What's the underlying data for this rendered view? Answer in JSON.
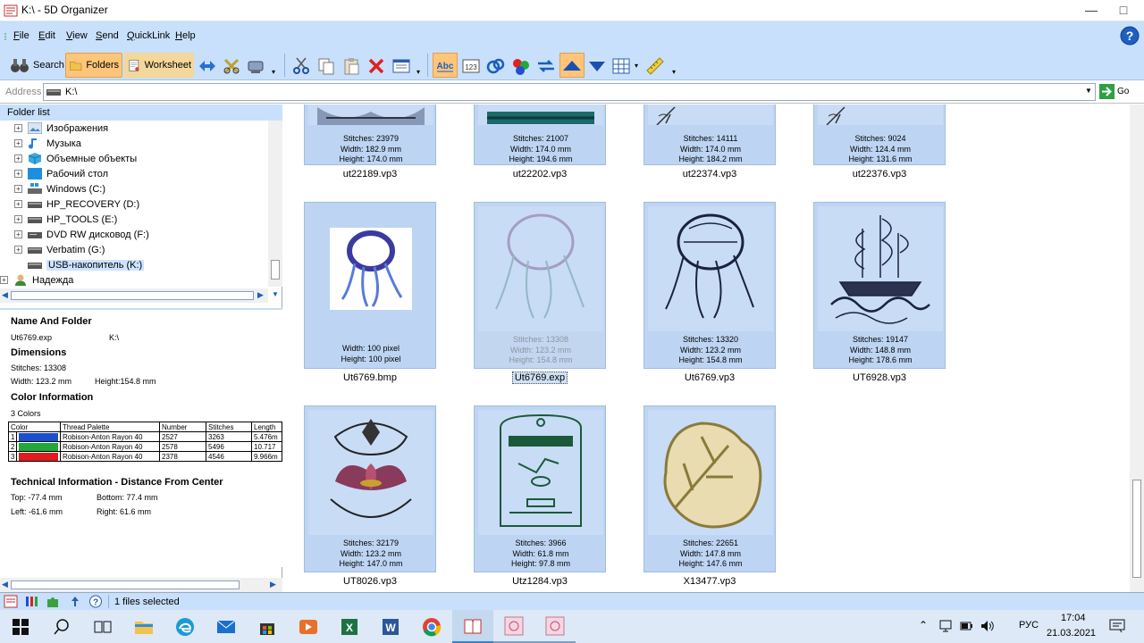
{
  "window": {
    "title": "K:\\ - 5D Organizer"
  },
  "menu": [
    {
      "key": "F",
      "rest": "ile"
    },
    {
      "key": "E",
      "rest": "dit"
    },
    {
      "key": "V",
      "rest": "iew"
    },
    {
      "key": "S",
      "rest": "end"
    },
    {
      "key": "Q",
      "rest": "uickLink"
    },
    {
      "key": "H",
      "rest": "elp"
    }
  ],
  "toolbar": {
    "search": "Search",
    "folders": "Folders",
    "worksheet": "Worksheet"
  },
  "address": {
    "label": "Address",
    "value": "K:\\",
    "go": "Go"
  },
  "folder_list": {
    "header": "Folder list",
    "items": [
      {
        "label": "Изображения",
        "icon": "pictures-folder-icon"
      },
      {
        "label": "Музыка",
        "icon": "music-folder-icon"
      },
      {
        "label": "Объемные объекты",
        "icon": "3d-objects-icon"
      },
      {
        "label": "Рабочий стол",
        "icon": "desktop-folder-icon"
      },
      {
        "label": "Windows (C:)",
        "icon": "windows-drive-icon"
      },
      {
        "label": "HP_RECOVERY (D:)",
        "icon": "drive-icon"
      },
      {
        "label": "HP_TOOLS (E:)",
        "icon": "drive-icon"
      },
      {
        "label": "DVD RW дисковод (F:)",
        "icon": "dvd-drive-icon"
      },
      {
        "label": "Verbatim (G:)",
        "icon": "drive-icon"
      },
      {
        "label": "USB-накопитель (K:)",
        "icon": "usb-drive-icon"
      },
      {
        "label": "Надежда",
        "icon": "user-icon"
      }
    ]
  },
  "info": {
    "name_and_folder": "Name And Folder",
    "filename": "Ut6769.exp",
    "folder": "K:\\",
    "dimensions": "Dimensions",
    "stitches": "Stitches: 13308",
    "width": "Width: 123.2 mm",
    "height": "Height:154.8 mm",
    "color_information": "Color Information",
    "colors_count": "3 Colors",
    "color_table_headers": [
      "Color",
      "Thread Palette",
      "Number",
      "Stitches",
      "Length"
    ],
    "color_rows": [
      {
        "idx": "1",
        "color": "#1c4fcf",
        "palette": "Robison-Anton Rayon 40",
        "number": "2527",
        "stitches": "3263",
        "length": "5.476m"
      },
      {
        "idx": "2",
        "color": "#22a83a",
        "palette": "Robison-Anton Rayon 40",
        "number": "2578",
        "stitches": "5496",
        "length": "10.717"
      },
      {
        "idx": "3",
        "color": "#e01c1c",
        "palette": "Robison-Anton Rayon 40",
        "number": "2378",
        "stitches": "4546",
        "length": "9.966m"
      }
    ],
    "technical": "Technical Information - Distance From Center",
    "top": "Top: -77.4 mm",
    "bottom": "Bottom: 77.4 mm",
    "left": "Left: -61.6 mm",
    "right": "Right: 61.6 mm"
  },
  "files": [
    {
      "name": "ut22189.vp3",
      "lines": [
        "Stitches: 23979",
        "Width: 182.9 mm",
        "Height: 174.0 mm"
      ],
      "art": "landscape"
    },
    {
      "name": "ut22202.vp3",
      "lines": [
        "Stitches: 21007",
        "Width: 174.0 mm",
        "Height: 194.6 mm"
      ],
      "art": "landscape-teal"
    },
    {
      "name": "ut22374.vp3",
      "lines": [
        "Stitches: 14111",
        "Width: 174.0 mm",
        "Height: 184.2 mm"
      ],
      "art": "bamboo"
    },
    {
      "name": "ut22376.vp3",
      "lines": [
        "Stitches: 9024",
        "Width: 124.4 mm",
        "Height: 131.6 mm"
      ],
      "art": "bamboo"
    },
    {
      "name": "Ut6769.bmp",
      "lines": [
        "Width: 100 pixel",
        "Height: 100 pixel"
      ],
      "art": "jellyfish-blue"
    },
    {
      "name": "Ut6769.exp",
      "lines": [
        "Stitches: 13308",
        "Width: 123.2 mm",
        "Height: 154.8 mm"
      ],
      "art": "jellyfish-faded",
      "selected": true
    },
    {
      "name": "Ut6769.vp3",
      "lines": [
        "Stitches: 13320",
        "Width: 123.2 mm",
        "Height: 154.8 mm"
      ],
      "art": "jellyfish-dark"
    },
    {
      "name": "UT6928.vp3",
      "lines": [
        "Stitches: 19147",
        "Width: 148.8 mm",
        "Height: 178.6 mm"
      ],
      "art": "ship"
    },
    {
      "name": "UT8026.vp3",
      "lines": [
        "Stitches: 32179",
        "Width: 123.2 mm",
        "Height: 147.0 mm"
      ],
      "art": "lotus"
    },
    {
      "name": "Utz1284.vp3",
      "lines": [
        "Stitches: 3966",
        "Width: 61.8 mm",
        "Height: 97.8 mm"
      ],
      "art": "tag"
    },
    {
      "name": "X13477.vp3",
      "lines": [
        "Stitches: 22651",
        "Width: 147.8 mm",
        "Height: 147.6 mm"
      ],
      "art": "leaf"
    }
  ],
  "status": {
    "text": "1 files selected"
  },
  "taskbar": {
    "time": "17:04",
    "date": "21.03.2021",
    "lang": "РУС",
    "apps": [
      "windows-start-icon",
      "search-icon",
      "task-view-icon",
      "edge-icon",
      "mail-icon",
      "store-icon",
      "media-player-icon",
      "excel-icon",
      "word-icon",
      "chrome-icon",
      "5d-organizer-icon",
      "embroidery-app-icon",
      "embroidery-app-icon"
    ]
  }
}
